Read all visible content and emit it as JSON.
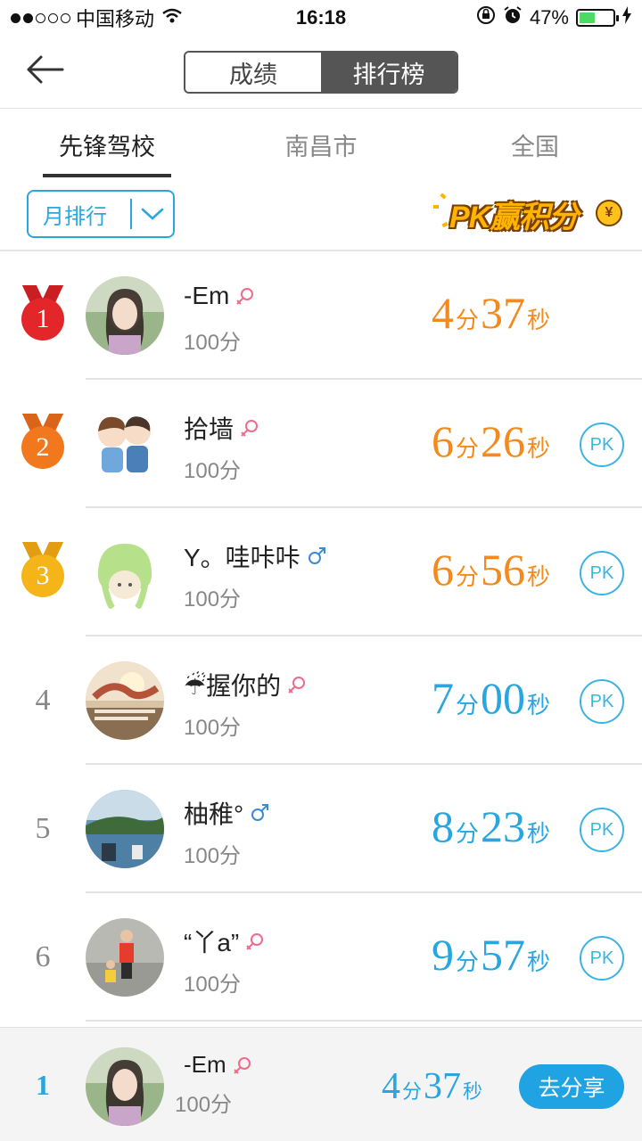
{
  "status_bar": {
    "carrier": "中国移动",
    "time": "16:18",
    "battery_pct": "47%",
    "battery_level": 0.47
  },
  "header": {
    "back_icon": "arrow-left-icon",
    "segments": [
      {
        "label": "成绩",
        "active": false
      },
      {
        "label": "排行榜",
        "active": true
      }
    ]
  },
  "tabs": [
    {
      "label": "先锋驾校",
      "active": true
    },
    {
      "label": "南昌市",
      "active": false
    },
    {
      "label": "全国",
      "active": false
    }
  ],
  "filter": {
    "label": "月排行",
    "icon": "chevron-down-icon"
  },
  "promo": {
    "text": "PK赢积分",
    "coin": "¥"
  },
  "rankings": [
    {
      "rank": "1",
      "name": "-Em",
      "gender": "female",
      "score": "100分",
      "min": "4",
      "min_unit": "分",
      "sec": "37",
      "sec_unit": "秒",
      "pk": "",
      "medal_color": "#e2262a",
      "time_color": "orange"
    },
    {
      "rank": "2",
      "name": "拾墙",
      "gender": "female",
      "score": "100分",
      "min": "6",
      "min_unit": "分",
      "sec": "26",
      "sec_unit": "秒",
      "pk": "PK",
      "medal_color": "#f2781e",
      "time_color": "orange"
    },
    {
      "rank": "3",
      "name": "Y。哇咔咔",
      "gender": "male",
      "score": "100分",
      "min": "6",
      "min_unit": "分",
      "sec": "56",
      "sec_unit": "秒",
      "pk": "PK",
      "medal_color": "#f5b417",
      "time_color": "orange"
    },
    {
      "rank": "4",
      "name": "☔握你的",
      "gender": "female",
      "score": "100分",
      "min": "7",
      "min_unit": "分",
      "sec": "00",
      "sec_unit": "秒",
      "pk": "PK",
      "medal_color": "",
      "time_color": "blue"
    },
    {
      "rank": "5",
      "name": "柚稚°",
      "gender": "male",
      "score": "100分",
      "min": "8",
      "min_unit": "分",
      "sec": "23",
      "sec_unit": "秒",
      "pk": "PK",
      "medal_color": "",
      "time_color": "blue"
    },
    {
      "rank": "6",
      "name": "“丫a”",
      "gender": "female",
      "score": "100分",
      "min": "9",
      "min_unit": "分",
      "sec": "57",
      "sec_unit": "秒",
      "pk": "PK",
      "medal_color": "",
      "time_color": "blue"
    }
  ],
  "me": {
    "rank": "1",
    "name": "-Em",
    "gender": "female",
    "score": "100分",
    "min": "4",
    "min_unit": "分",
    "sec": "37",
    "sec_unit": "秒",
    "share_label": "去分享"
  },
  "colors": {
    "accent_blue": "#2aa6de",
    "orange": "#f38a1d",
    "female": "#f06b8b",
    "male": "#3b8ad6"
  }
}
